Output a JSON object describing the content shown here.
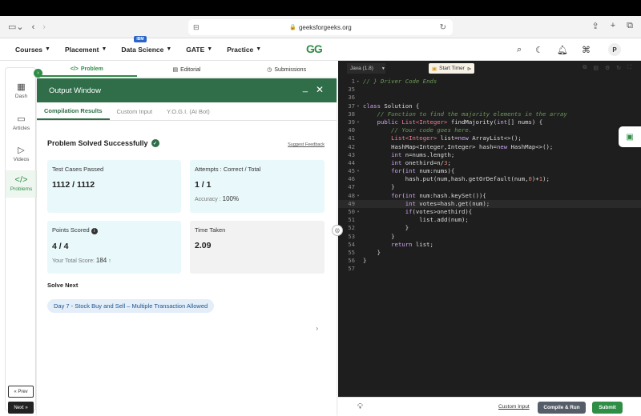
{
  "browser": {
    "url": "geeksforgeeks.org"
  },
  "nav": {
    "items": [
      {
        "label": "Courses"
      },
      {
        "label": "Placement"
      },
      {
        "label": "Data Science",
        "badge": "IBM"
      },
      {
        "label": "GATE"
      },
      {
        "label": "Practice"
      }
    ],
    "logo": "GG",
    "avatar": "P"
  },
  "rail": {
    "items": [
      "Dash",
      "Articles",
      "Videos",
      "Problems"
    ],
    "prev": "« Prev",
    "next": "Next »"
  },
  "problem_tabs": [
    "Problem",
    "Editorial",
    "Submissions"
  ],
  "output": {
    "title": "Output Window",
    "tabs": [
      "Compilation Results",
      "Custom Input",
      "Y.O.G.I. (AI Bot)"
    ],
    "status": "Problem Solved Successfully",
    "feedback": "Suggest Feedback",
    "cards": {
      "tests_label": "Test Cases Passed",
      "tests_value": "1112 / 1112",
      "attempts_label": "Attempts : Correct / Total",
      "attempts_value": "1 / 1",
      "accuracy_label": "Accuracy :",
      "accuracy_value": "100%",
      "points_label": "Points Scored",
      "points_value": "4 / 4",
      "total_label": "Your Total Score:",
      "total_value": "184",
      "time_label": "Time Taken",
      "time_value": "2.09"
    },
    "solve_next_label": "Solve Next",
    "solve_next_item": "Day 7 - Stock Buy and Sell – Multiple Transaction Allowed"
  },
  "editor": {
    "language": "Java (1.8)",
    "timer_label": "Start Timer",
    "custom_input": "Custom Input",
    "compile_run": "Compile & Run",
    "submit": "Submit",
    "lines": [
      {
        "n": "1",
        "fold": "▸",
        "html": "<span class=\"cm\">// } Driver Code Ends</span>"
      },
      {
        "n": "35",
        "fold": "",
        "html": ""
      },
      {
        "n": "36",
        "fold": "",
        "html": ""
      },
      {
        "n": "37",
        "fold": "▾",
        "html": "<span class=\"kw\">class</span> Solution {"
      },
      {
        "n": "38",
        "fold": "",
        "html": "    <span class=\"cm\">// Function to find the majority elements in the array</span>"
      },
      {
        "n": "39",
        "fold": "▾",
        "html": "    <span class=\"kw\">public</span> <span class=\"kw2\">List&lt;Integer&gt;</span> findMajority(<span class=\"kw\">int</span>[] nums) {"
      },
      {
        "n": "40",
        "fold": "",
        "html": "        <span class=\"cm\">// Your code goes here.</span>"
      },
      {
        "n": "41",
        "fold": "",
        "html": "        <span class=\"kw2\">List&lt;Integer&gt;</span> list=<span class=\"kw\">new</span> ArrayList&lt;&gt;();"
      },
      {
        "n": "42",
        "fold": "",
        "html": "        HashMap&lt;Integer,Integer&gt; hash=<span class=\"kw\">new</span> HashMap&lt;&gt;();"
      },
      {
        "n": "43",
        "fold": "",
        "html": "        <span class=\"kw\">int</span> n=nums.length;"
      },
      {
        "n": "44",
        "fold": "",
        "html": "        <span class=\"kw\">int</span> onethird=n/<span class=\"num\">3</span>;"
      },
      {
        "n": "45",
        "fold": "▾",
        "html": "        <span class=\"kw\">for</span>(<span class=\"kw\">int</span> num:nums){"
      },
      {
        "n": "46",
        "fold": "",
        "html": "            hash.put(num,hash.getOrDefault(num,<span class=\"num\">0</span>)+<span class=\"num\">1</span>);"
      },
      {
        "n": "47",
        "fold": "",
        "html": "        }"
      },
      {
        "n": "48",
        "fold": "▾",
        "html": "        <span class=\"kw\">for</span>(<span class=\"kw\">int</span> num:hash.keySet()){"
      },
      {
        "n": "49",
        "fold": "",
        "html": "            <span class=\"kw\">int</span> votes=hash.get(num);",
        "hl": true
      },
      {
        "n": "50",
        "fold": "▾",
        "html": "            <span class=\"kw\">if</span>(votes&gt;onethird){"
      },
      {
        "n": "51",
        "fold": "",
        "html": "                list.add(num);"
      },
      {
        "n": "52",
        "fold": "",
        "html": "            }"
      },
      {
        "n": "53",
        "fold": "",
        "html": "        }"
      },
      {
        "n": "54",
        "fold": "",
        "html": "        <span class=\"kw\">return</span> list;"
      },
      {
        "n": "55",
        "fold": "",
        "html": "    }"
      },
      {
        "n": "56",
        "fold": "",
        "html": "}"
      },
      {
        "n": "57",
        "fold": "",
        "html": ""
      }
    ]
  },
  "colors": {
    "brand_green": "#2f8d46",
    "header_green": "#2f6e49"
  }
}
